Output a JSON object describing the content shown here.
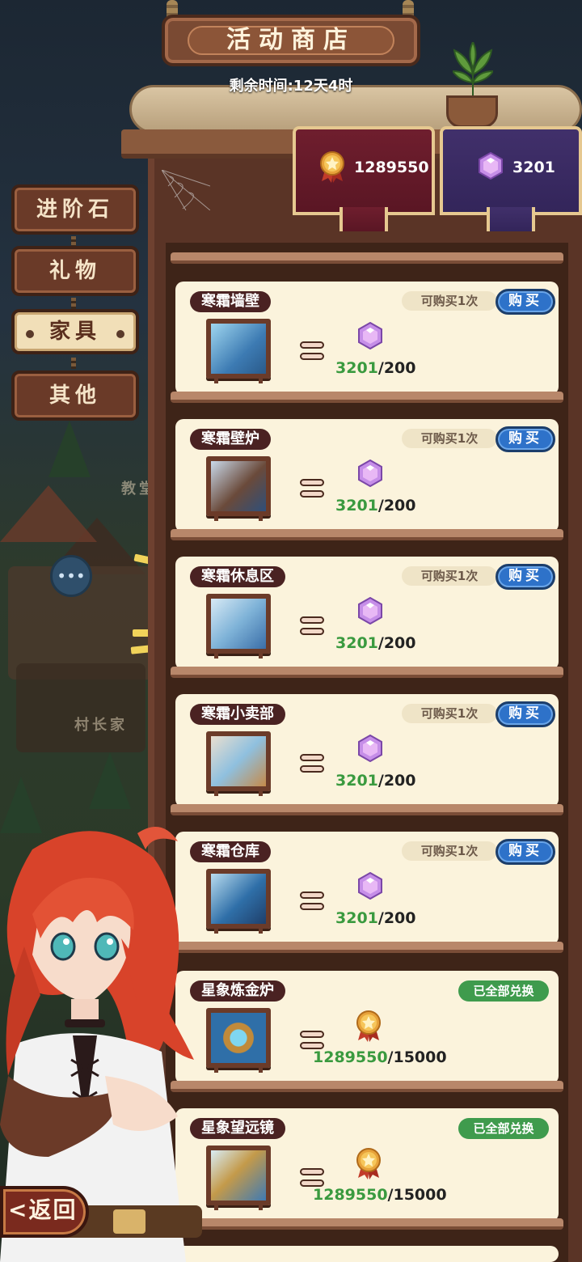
{
  "header": {
    "title": "活动商店",
    "remaining_time": "剩余时间:12天4时"
  },
  "currencies": [
    {
      "name": "medal",
      "icon": "medal-icon",
      "amount": "1289550",
      "color": "#6f1e2e"
    },
    {
      "name": "gem",
      "icon": "gem-icon",
      "amount": "3201",
      "color": "#41306b"
    }
  ],
  "tabs": [
    {
      "label": "进阶石",
      "active": false
    },
    {
      "label": "礼物",
      "active": false
    },
    {
      "label": "家具",
      "active": true
    },
    {
      "label": "其他",
      "active": false
    }
  ],
  "background_signs": [
    "教堂",
    "村长家"
  ],
  "items": [
    {
      "name": "寒霜墙壁",
      "limit": "可购买1次",
      "action": "购买",
      "currency": "gem",
      "have": "3201",
      "cost": "/200"
    },
    {
      "name": "寒霜壁炉",
      "limit": "可购买1次",
      "action": "购买",
      "currency": "gem",
      "have": "3201",
      "cost": "/200"
    },
    {
      "name": "寒霜休息区",
      "limit": "可购买1次",
      "action": "购买",
      "currency": "gem",
      "have": "3201",
      "cost": "/200"
    },
    {
      "name": "寒霜小卖部",
      "limit": "可购买1次",
      "action": "购买",
      "currency": "gem",
      "have": "3201",
      "cost": "/200"
    },
    {
      "name": "寒霜仓库",
      "limit": "可购买1次",
      "action": "购买",
      "currency": "gem",
      "have": "3201",
      "cost": "/200"
    },
    {
      "name": "星象炼金炉",
      "status": "已全部兑换",
      "currency": "medal",
      "have": "1289550",
      "cost": "/15000"
    },
    {
      "name": "星象望远镜",
      "status": "已全部兑换",
      "currency": "medal",
      "have": "1289550",
      "cost": "/15000"
    }
  ],
  "footer": {
    "back_label": "返回",
    "back_arrow": "<"
  },
  "colors": {
    "accent_buy": "#2e72c9",
    "done_green": "#3f9b4d",
    "have_green": "#3a9a3f",
    "card_bg": "#fbf3dc"
  }
}
